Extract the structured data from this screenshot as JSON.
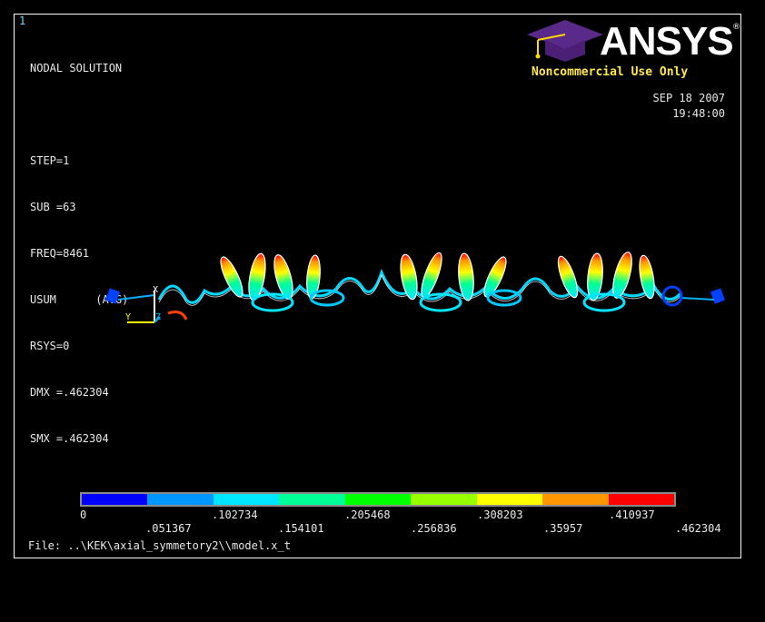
{
  "window_number": "1",
  "info_lines": [
    "NODAL SOLUTION",
    "",
    "STEP=1",
    "SUB =63",
    "FREQ=8461",
    "USUM      (AVG)",
    "RSYS=0",
    "DMX =.462304",
    "SMX =.462304"
  ],
  "logo": {
    "brand": "ANSYS",
    "registered": "®",
    "notice": "Noncommercial Use Only"
  },
  "date": "SEP 18 2007",
  "time": "19:48:00",
  "axis_labels": {
    "x": "X",
    "y": "Y",
    "z": "Z"
  },
  "legend": {
    "colors": [
      "#0000ff",
      "#0096ff",
      "#00e6ff",
      "#00ff96",
      "#00ff00",
      "#96ff00",
      "#ffff00",
      "#ff9600",
      "#ff0000"
    ],
    "upper_labels": [
      "0",
      ".102734",
      ".205468",
      ".308203",
      ".410937"
    ],
    "lower_labels": [
      ".051367",
      ".154101",
      ".256836",
      ".35957",
      ".462304"
    ]
  },
  "file_label": "File: ..\\KEK\\axial_symmetory2\\\\model.x_t"
}
